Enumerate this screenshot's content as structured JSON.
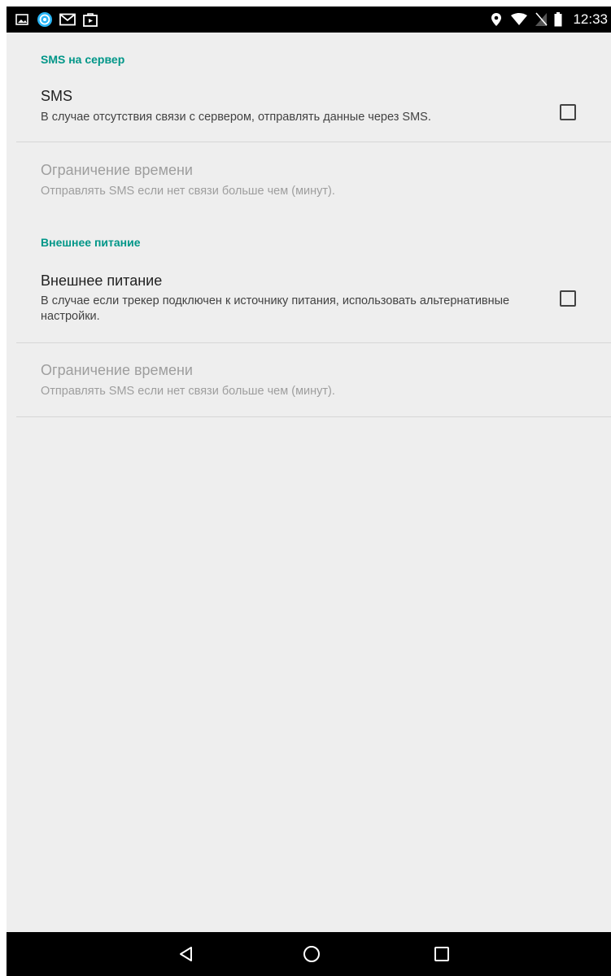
{
  "status_bar": {
    "time": "12:33",
    "left_icons": [
      "image-icon",
      "location-app-icon",
      "mail-icon",
      "shop-bag-icon"
    ],
    "right_icons": [
      "location-pin-icon",
      "wifi-icon",
      "no-sim-icon",
      "battery-icon"
    ]
  },
  "sections": [
    {
      "category": "SMS на сервер",
      "prefs": [
        {
          "title": "SMS",
          "summary": "В случае отсутствия связи с сервером, отправлять данные через SMS.",
          "checkbox": true,
          "checked": false,
          "enabled": true
        },
        {
          "title": "Ограничение времени",
          "summary": "Отправлять SMS если нет связи больше чем (минут).",
          "checkbox": false,
          "enabled": false
        }
      ]
    },
    {
      "category": "Внешнее питание",
      "prefs": [
        {
          "title": "Внешнее питание",
          "summary": "В случае если трекер подключен к источнику питания, использовать альтернативные настройки.",
          "checkbox": true,
          "checked": false,
          "enabled": true
        },
        {
          "title": "Ограничение времени",
          "summary": "Отправлять SMS если нет связи больше чем (минут).",
          "checkbox": false,
          "enabled": false
        }
      ]
    }
  ],
  "nav_bar": {
    "buttons": [
      "back-icon",
      "home-icon",
      "recents-icon"
    ]
  },
  "colors": {
    "accent": "#009688",
    "background": "#eeeeee",
    "bars": "#000000"
  }
}
